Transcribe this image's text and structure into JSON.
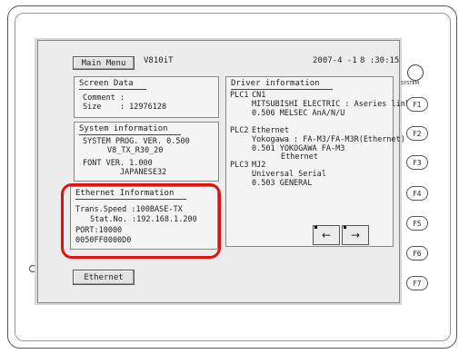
{
  "header": {
    "main_menu": "Main Menu",
    "model": "V810iT",
    "date": "2007-4 -1",
    "time": "8 :30:15"
  },
  "screen_data": {
    "title": "Screen Data",
    "comment": "Comment :",
    "size": "Size    : 12976128"
  },
  "system_info": {
    "title": "System information",
    "line1": "SYSTEM PROG. VER. 0.500",
    "line2": "V8_TX_R30_20",
    "line3": "FONT VER. 1.000",
    "line4": "JAPANESE32"
  },
  "ethernet_info": {
    "title": "Ethernet Information",
    "line1": "Trans.Speed :100BASE-TX",
    "line2": "Stat.No. :192.168.1.200",
    "line3": "PORT:10000",
    "line4": "0050FF0000D0"
  },
  "driver_info": {
    "title": "Driver information",
    "plc1_label": "PLC1",
    "plc1_l1": "CN1",
    "plc1_l2": "MITSUBISHI ELECTRIC : Aseries link",
    "plc1_l3": "0.506 MELSEC AnA/N/U",
    "plc2_label": "PLC2",
    "plc2_l1": "Ethernet",
    "plc2_l2": "Yokogawa : FA-M3/FA-M3R(Ethernet)",
    "plc2_l3": "0.501 YOKOGAWA FA-M3",
    "plc2_l4": "Ethernet",
    "plc3_label": "PLC3",
    "plc3_l1": "MJ2",
    "plc3_l2": "Universal Serial",
    "plc3_l3": "0.503 GENERAL"
  },
  "nav": {
    "prev": "←",
    "next": "→"
  },
  "ethernet_button": "Ethernet",
  "side_buttons": {
    "system": "SYSTEM",
    "f1": "F1",
    "f2": "F2",
    "f3": "F3",
    "f4": "F4",
    "f5": "F5",
    "f6": "F6",
    "f7": "F7"
  },
  "colors": {
    "highlight": "#e11111"
  }
}
